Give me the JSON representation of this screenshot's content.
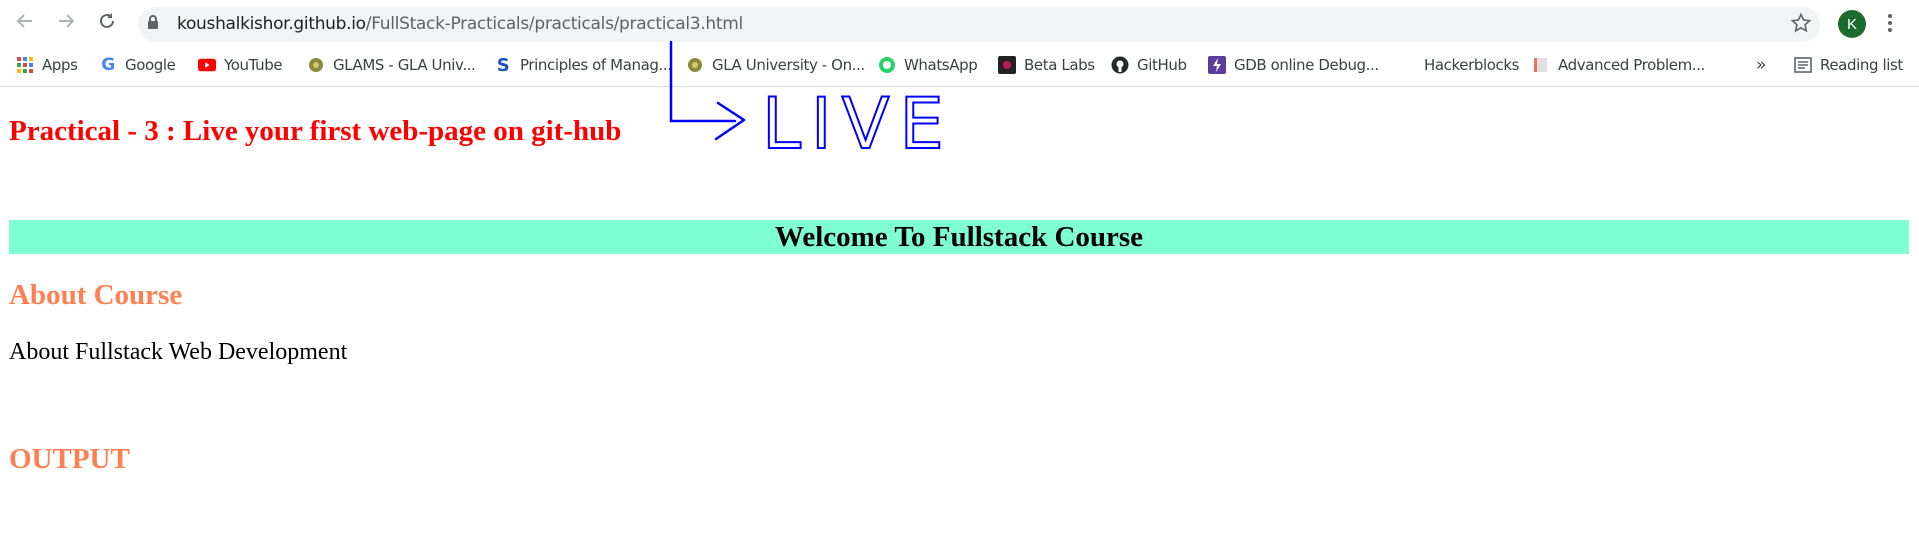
{
  "browser": {
    "url_host": "koushalkishor.github.io",
    "url_path": "/FullStack-Practicals/practicals/practical3.html",
    "avatar_initial": "K"
  },
  "bookmarks": [
    {
      "label": "Apps",
      "icon": "apps-grid-icon"
    },
    {
      "label": "Google",
      "icon": "google-icon"
    },
    {
      "label": "YouTube",
      "icon": "youtube-icon"
    },
    {
      "label": "GLAMS - GLA Univ...",
      "icon": "gla-icon"
    },
    {
      "label": "Principles of Manag...",
      "icon": "s-icon"
    },
    {
      "label": "GLA University - On...",
      "icon": "gla-icon"
    },
    {
      "label": "WhatsApp",
      "icon": "whatsapp-icon"
    },
    {
      "label": "Beta Labs",
      "icon": "betalabs-icon"
    },
    {
      "label": "GitHub",
      "icon": "github-icon"
    },
    {
      "label": "GDB online Debug...",
      "icon": "gdb-icon"
    },
    {
      "label": "Hackerblocks",
      "icon": ""
    },
    {
      "label": "Advanced Problem...",
      "icon": "book-icon"
    }
  ],
  "bookmarks_more": "»",
  "reading_list": "Reading list",
  "page": {
    "title": "Practical - 3 : Live your first web-page on git-hub",
    "welcome": "Welcome To Fullstack Course",
    "about_heading": "About Course",
    "about_text": "About Fullstack Web Development",
    "output_heading": "OUTPUT"
  },
  "annotation": {
    "text": "LIVE",
    "color": "#0000ff"
  },
  "colors": {
    "title_red": "#ff0000",
    "heading_coral": "#ff7f50",
    "welcome_bg": "#7fffd4"
  }
}
